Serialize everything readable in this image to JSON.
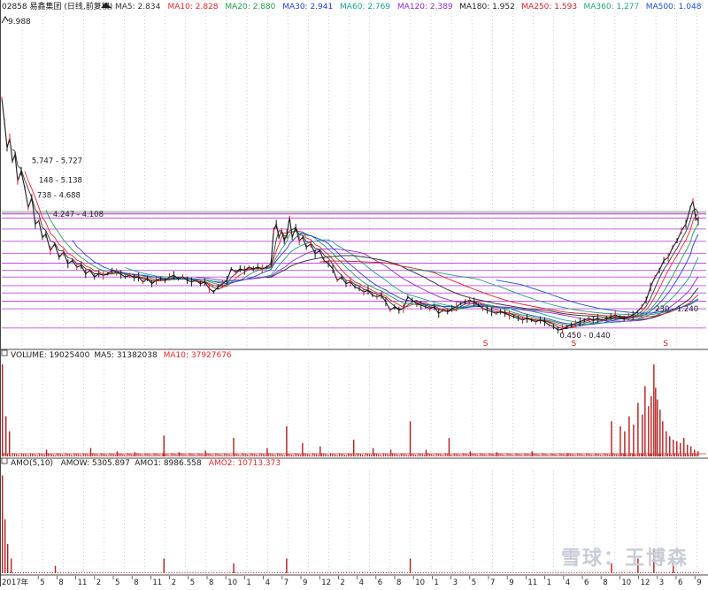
{
  "colors": {
    "background": "#ffffff",
    "price": "#1a1a1a",
    "ma5": "#333333",
    "ma10": "#e0282b",
    "ma20": "#1f9e4a",
    "ma30": "#1f3fcf",
    "ma60": "#18a08c",
    "ma120": "#8c2bd0",
    "ma180": "#222222",
    "ma250": "#d4232a",
    "ma360": "#24a07a",
    "ma500": "#1a4fd0",
    "grid": "#9aa0b5",
    "level_line": "#c04be0",
    "volume_bar": "#b21e1e",
    "signal": "#d42020"
  },
  "chart_data": [
    {
      "type": "line",
      "panel": "price",
      "title": "02858 易鑫集团 (日线,前复权)",
      "indicators": [
        {
          "name": "MA5",
          "value": "2.834",
          "color": "#333333"
        },
        {
          "name": "MA10",
          "value": "2.828",
          "color": "#e0282b"
        },
        {
          "name": "MA20",
          "value": "2.880",
          "color": "#1f9e4a"
        },
        {
          "name": "MA30",
          "value": "2.941",
          "color": "#1f3fcf"
        },
        {
          "name": "MA60",
          "value": "2.769",
          "color": "#18a08c"
        },
        {
          "name": "MA120",
          "value": "2.389",
          "color": "#8c2bd0"
        },
        {
          "name": "MA180",
          "value": "1.952",
          "color": "#222222"
        },
        {
          "name": "MA250",
          "value": "1.593",
          "color": "#d4232a"
        },
        {
          "name": "MA360",
          "value": "1.277",
          "color": "#24a07a"
        },
        {
          "name": "MA500",
          "value": "1.048",
          "color": "#1a4fd0"
        }
      ],
      "y_label_top": "9.988",
      "ylim": [
        0.2,
        10.2
      ],
      "annotations": [
        "5.747 - 5.727",
        "148 - 5.138",
        "738 - 4.688",
        "4.247 - 4.108",
        "0.450 - 0.440",
        "230 - 1.240"
      ],
      "level_values": [
        4.108,
        3.98,
        3.65,
        3.28,
        2.92,
        2.62,
        2.4,
        2.2,
        1.94,
        1.72,
        1.47,
        1.24,
        0.66
      ],
      "signal_markers": [
        "S",
        "S",
        "S"
      ],
      "price_points": [
        [
          0,
          7.6
        ],
        [
          3,
          6.9
        ],
        [
          6,
          6.1
        ],
        [
          9,
          6.4
        ],
        [
          12,
          5.7
        ],
        [
          15,
          5.9
        ],
        [
          18,
          5.1
        ],
        [
          22,
          5.4
        ],
        [
          26,
          4.9
        ],
        [
          30,
          4.3
        ],
        [
          34,
          4.6
        ],
        [
          38,
          3.8
        ],
        [
          42,
          3.9
        ],
        [
          46,
          3.4
        ],
        [
          50,
          3.5
        ],
        [
          55,
          3.0
        ],
        [
          60,
          3.2
        ],
        [
          65,
          2.8
        ],
        [
          70,
          2.95
        ],
        [
          75,
          2.6
        ],
        [
          80,
          2.7
        ],
        [
          85,
          2.5
        ],
        [
          90,
          2.55
        ],
        [
          95,
          2.3
        ],
        [
          100,
          2.4
        ],
        [
          105,
          2.2
        ],
        [
          110,
          2.3
        ],
        [
          115,
          2.25
        ],
        [
          120,
          2.3
        ],
        [
          125,
          2.4
        ],
        [
          130,
          2.35
        ],
        [
          135,
          2.28
        ],
        [
          140,
          2.2
        ],
        [
          145,
          2.25
        ],
        [
          150,
          2.18
        ],
        [
          155,
          2.2
        ],
        [
          160,
          2.05
        ],
        [
          165,
          2.15
        ],
        [
          170,
          2.0
        ],
        [
          175,
          2.1
        ],
        [
          180,
          2.15
        ],
        [
          185,
          2.1
        ],
        [
          190,
          2.2
        ],
        [
          195,
          2.25
        ],
        [
          200,
          2.15
        ],
        [
          205,
          2.2
        ],
        [
          210,
          2.1
        ],
        [
          215,
          2.05
        ],
        [
          220,
          2.1
        ],
        [
          225,
          2.0
        ],
        [
          230,
          2.05
        ],
        [
          235,
          1.85
        ],
        [
          240,
          1.75
        ],
        [
          245,
          1.9
        ],
        [
          250,
          2.0
        ],
        [
          255,
          2.1
        ],
        [
          260,
          2.45
        ],
        [
          265,
          2.35
        ],
        [
          270,
          2.45
        ],
        [
          275,
          2.4
        ],
        [
          280,
          2.5
        ],
        [
          285,
          2.45
        ],
        [
          290,
          2.5
        ],
        [
          295,
          2.45
        ],
        [
          300,
          2.5
        ],
        [
          305,
          2.6
        ],
        [
          308,
          3.6
        ],
        [
          311,
          3.8
        ],
        [
          314,
          3.4
        ],
        [
          317,
          3.6
        ],
        [
          320,
          3.3
        ],
        [
          323,
          3.5
        ],
        [
          326,
          4.0
        ],
        [
          329,
          3.4
        ],
        [
          333,
          3.7
        ],
        [
          337,
          3.3
        ],
        [
          341,
          3.4
        ],
        [
          345,
          3.1
        ],
        [
          350,
          3.2
        ],
        [
          355,
          2.9
        ],
        [
          360,
          3.0
        ],
        [
          365,
          2.7
        ],
        [
          370,
          2.6
        ],
        [
          375,
          2.45
        ],
        [
          380,
          2.1
        ],
        [
          385,
          2.2
        ],
        [
          390,
          2.0
        ],
        [
          395,
          2.05
        ],
        [
          400,
          1.9
        ],
        [
          405,
          1.85
        ],
        [
          410,
          1.75
        ],
        [
          415,
          1.8
        ],
        [
          420,
          1.65
        ],
        [
          425,
          1.6
        ],
        [
          430,
          1.65
        ],
        [
          435,
          1.45
        ],
        [
          440,
          1.2
        ],
        [
          445,
          1.3
        ],
        [
          450,
          1.2
        ],
        [
          455,
          1.25
        ],
        [
          460,
          1.6
        ],
        [
          465,
          1.5
        ],
        [
          470,
          1.4
        ],
        [
          475,
          1.35
        ],
        [
          480,
          1.3
        ],
        [
          485,
          1.25
        ],
        [
          490,
          1.3
        ],
        [
          495,
          1.1
        ],
        [
          500,
          1.2
        ],
        [
          505,
          1.15
        ],
        [
          510,
          1.25
        ],
        [
          515,
          1.3
        ],
        [
          520,
          1.4
        ],
        [
          525,
          1.45
        ],
        [
          530,
          1.5
        ],
        [
          535,
          1.45
        ],
        [
          540,
          1.35
        ],
        [
          545,
          1.25
        ],
        [
          550,
          1.2
        ],
        [
          555,
          1.15
        ],
        [
          560,
          1.1
        ],
        [
          565,
          1.15
        ],
        [
          570,
          1.1
        ],
        [
          575,
          1.05
        ],
        [
          580,
          1.0
        ],
        [
          585,
          0.95
        ],
        [
          590,
          0.9
        ],
        [
          595,
          0.95
        ],
        [
          600,
          0.9
        ],
        [
          605,
          0.85
        ],
        [
          610,
          0.9
        ],
        [
          615,
          0.85
        ],
        [
          620,
          0.75
        ],
        [
          625,
          0.7
        ],
        [
          630,
          0.6
        ],
        [
          635,
          0.62
        ],
        [
          640,
          0.7
        ],
        [
          645,
          0.75
        ],
        [
          650,
          0.8
        ],
        [
          655,
          0.85
        ],
        [
          660,
          0.9
        ],
        [
          665,
          0.95
        ],
        [
          670,
          0.9
        ],
        [
          675,
          0.95
        ],
        [
          680,
          0.9
        ],
        [
          685,
          0.95
        ],
        [
          690,
          1.0
        ],
        [
          695,
          1.05
        ],
        [
          700,
          1.0
        ],
        [
          705,
          0.95
        ],
        [
          710,
          1.0
        ],
        [
          715,
          1.05
        ],
        [
          720,
          1.15
        ],
        [
          725,
          1.3
        ],
        [
          730,
          1.5
        ],
        [
          735,
          1.9
        ],
        [
          740,
          2.2
        ],
        [
          745,
          2.4
        ],
        [
          750,
          2.7
        ],
        [
          755,
          2.8
        ],
        [
          760,
          3.1
        ],
        [
          765,
          3.3
        ],
        [
          770,
          3.6
        ],
        [
          775,
          3.8
        ],
        [
          780,
          4.3
        ],
        [
          783,
          4.5
        ],
        [
          786,
          4.0
        ],
        [
          789,
          3.9
        ]
      ]
    },
    {
      "type": "bar",
      "panel": "volume",
      "header": [
        {
          "text": "VOLUME: 19025400",
          "color": "#1a1a1a"
        },
        {
          "text": "MA5: 31382038",
          "color": "#1a1a1a"
        },
        {
          "text": "MA10: 37927676",
          "color": "#e0282b"
        }
      ],
      "spikes": [
        [
          0,
          110
        ],
        [
          4,
          48
        ],
        [
          8,
          30
        ],
        [
          50,
          8
        ],
        [
          100,
          10
        ],
        [
          130,
          6
        ],
        [
          150,
          5
        ],
        [
          183,
          25
        ],
        [
          200,
          5
        ],
        [
          230,
          7
        ],
        [
          262,
          22
        ],
        [
          300,
          10
        ],
        [
          322,
          36
        ],
        [
          340,
          16
        ],
        [
          360,
          12
        ],
        [
          398,
          20
        ],
        [
          420,
          10
        ],
        [
          440,
          8
        ],
        [
          462,
          42
        ],
        [
          480,
          8
        ],
        [
          506,
          22
        ],
        [
          530,
          6
        ],
        [
          560,
          5
        ],
        [
          600,
          6
        ],
        [
          640,
          4
        ],
        [
          690,
          42
        ],
        [
          700,
          36
        ],
        [
          705,
          30
        ],
        [
          710,
          48
        ],
        [
          715,
          38
        ],
        [
          720,
          64
        ],
        [
          725,
          50
        ],
        [
          728,
          84
        ],
        [
          732,
          60
        ],
        [
          735,
          72
        ],
        [
          738,
          110
        ],
        [
          740,
          82
        ],
        [
          742,
          68
        ],
        [
          745,
          56
        ],
        [
          748,
          42
        ],
        [
          752,
          30
        ],
        [
          756,
          24
        ],
        [
          760,
          20
        ],
        [
          764,
          18
        ],
        [
          768,
          16
        ],
        [
          772,
          22
        ],
        [
          776,
          14
        ],
        [
          780,
          12
        ],
        [
          784,
          8
        ],
        [
          788,
          6
        ]
      ]
    },
    {
      "type": "area",
      "panel": "amo",
      "header": [
        {
          "text": "AMO(5,10)",
          "color": "#1a1a1a"
        },
        {
          "text": "AMOW: 5305.897",
          "color": "#1a1a1a"
        },
        {
          "text": "AMO1: 8986.558",
          "color": "#1a1a1a"
        },
        {
          "text": "AMO2: 10713.373",
          "color": "#e0282b"
        }
      ],
      "spikes": [
        [
          0,
          40
        ],
        [
          3,
          22
        ],
        [
          6,
          12
        ],
        [
          10,
          6
        ],
        [
          60,
          3
        ],
        [
          183,
          6
        ],
        [
          262,
          4
        ],
        [
          322,
          6
        ],
        [
          462,
          6
        ],
        [
          690,
          4
        ],
        [
          720,
          6
        ],
        [
          738,
          10
        ],
        [
          760,
          4
        ]
      ]
    }
  ],
  "x_axis": {
    "labels": [
      "2017年",
      "5",
      "8",
      "11",
      "2",
      "5",
      "8",
      "11",
      "2",
      "5",
      "8",
      "10",
      "1",
      "4",
      "7",
      "9",
      "12",
      "2",
      "4",
      "6",
      "8",
      "10",
      "1",
      "3",
      "5",
      "7",
      "9",
      "11",
      "1",
      "4",
      "6",
      "8",
      "10",
      "12",
      "3",
      "6",
      "9"
    ]
  },
  "watermark": "雪球：王博森"
}
